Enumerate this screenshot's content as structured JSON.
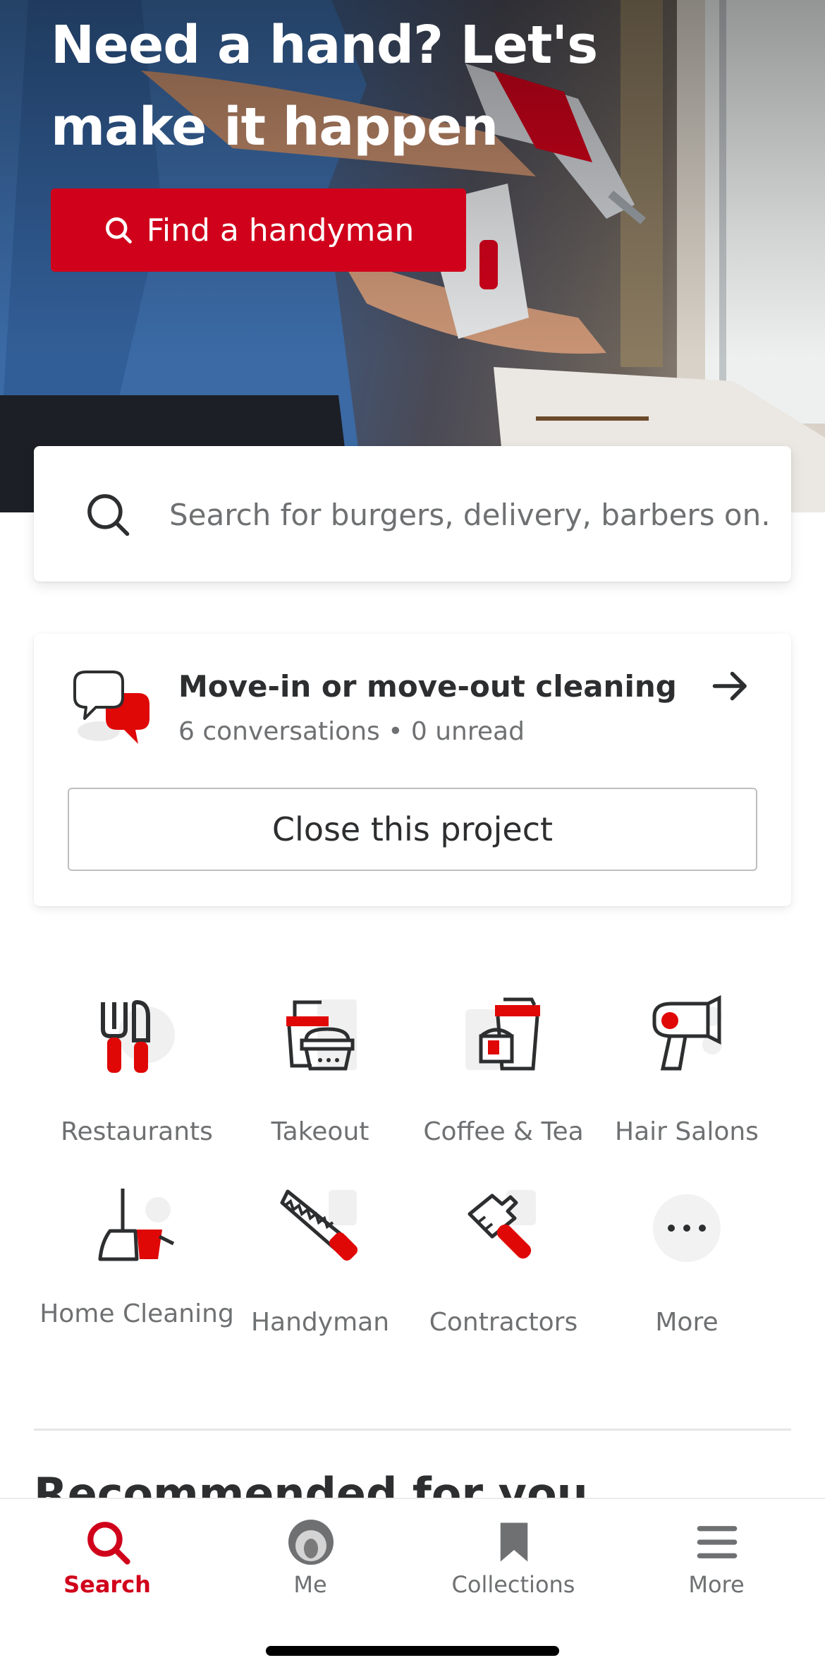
{
  "hero": {
    "title": "Need a hand? Let's make it happen",
    "button_label": "Find a handyman"
  },
  "search": {
    "placeholder": "Search for burgers, delivery, barbers on..."
  },
  "project": {
    "title": "Move-in or move-out cleaning",
    "subtitle": "6 conversations • 0 unread",
    "close_label": "Close this project"
  },
  "categories": [
    {
      "label": "Restaurants",
      "icon": "fork-knife-icon"
    },
    {
      "label": "Takeout",
      "icon": "takeout-bag-icon"
    },
    {
      "label": "Coffee & Tea",
      "icon": "coffee-cup-icon"
    },
    {
      "label": "Hair Salons",
      "icon": "hair-dryer-icon"
    },
    {
      "label": "Home Cleaning",
      "icon": "broom-bucket-icon"
    },
    {
      "label": "Handyman",
      "icon": "saw-icon"
    },
    {
      "label": "Contractors",
      "icon": "hammer-icon"
    },
    {
      "label": "More",
      "icon": "more-dots-icon"
    }
  ],
  "recommended": {
    "title": "Recommended for you"
  },
  "tabs": [
    {
      "label": "Search",
      "icon": "search-icon",
      "active": true
    },
    {
      "label": "Me",
      "icon": "avatar-icon",
      "active": false
    },
    {
      "label": "Collections",
      "icon": "bookmark-icon",
      "active": false
    },
    {
      "label": "More",
      "icon": "menu-icon",
      "active": false
    }
  ],
  "colors": {
    "accent": "#d0021b",
    "text": "#2d2e2f",
    "muted": "#6e7072"
  }
}
